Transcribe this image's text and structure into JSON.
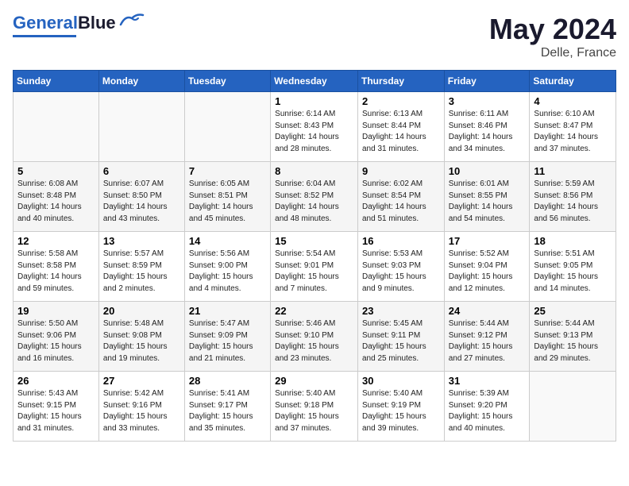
{
  "header": {
    "logo_general": "General",
    "logo_blue": "Blue",
    "month_title": "May 2024",
    "subtitle": "Delle, France"
  },
  "days_of_week": [
    "Sunday",
    "Monday",
    "Tuesday",
    "Wednesday",
    "Thursday",
    "Friday",
    "Saturday"
  ],
  "weeks": [
    [
      {
        "day": "",
        "info": ""
      },
      {
        "day": "",
        "info": ""
      },
      {
        "day": "",
        "info": ""
      },
      {
        "day": "1",
        "info": "Sunrise: 6:14 AM\nSunset: 8:43 PM\nDaylight: 14 hours\nand 28 minutes."
      },
      {
        "day": "2",
        "info": "Sunrise: 6:13 AM\nSunset: 8:44 PM\nDaylight: 14 hours\nand 31 minutes."
      },
      {
        "day": "3",
        "info": "Sunrise: 6:11 AM\nSunset: 8:46 PM\nDaylight: 14 hours\nand 34 minutes."
      },
      {
        "day": "4",
        "info": "Sunrise: 6:10 AM\nSunset: 8:47 PM\nDaylight: 14 hours\nand 37 minutes."
      }
    ],
    [
      {
        "day": "5",
        "info": "Sunrise: 6:08 AM\nSunset: 8:48 PM\nDaylight: 14 hours\nand 40 minutes."
      },
      {
        "day": "6",
        "info": "Sunrise: 6:07 AM\nSunset: 8:50 PM\nDaylight: 14 hours\nand 43 minutes."
      },
      {
        "day": "7",
        "info": "Sunrise: 6:05 AM\nSunset: 8:51 PM\nDaylight: 14 hours\nand 45 minutes."
      },
      {
        "day": "8",
        "info": "Sunrise: 6:04 AM\nSunset: 8:52 PM\nDaylight: 14 hours\nand 48 minutes."
      },
      {
        "day": "9",
        "info": "Sunrise: 6:02 AM\nSunset: 8:54 PM\nDaylight: 14 hours\nand 51 minutes."
      },
      {
        "day": "10",
        "info": "Sunrise: 6:01 AM\nSunset: 8:55 PM\nDaylight: 14 hours\nand 54 minutes."
      },
      {
        "day": "11",
        "info": "Sunrise: 5:59 AM\nSunset: 8:56 PM\nDaylight: 14 hours\nand 56 minutes."
      }
    ],
    [
      {
        "day": "12",
        "info": "Sunrise: 5:58 AM\nSunset: 8:58 PM\nDaylight: 14 hours\nand 59 minutes."
      },
      {
        "day": "13",
        "info": "Sunrise: 5:57 AM\nSunset: 8:59 PM\nDaylight: 15 hours\nand 2 minutes."
      },
      {
        "day": "14",
        "info": "Sunrise: 5:56 AM\nSunset: 9:00 PM\nDaylight: 15 hours\nand 4 minutes."
      },
      {
        "day": "15",
        "info": "Sunrise: 5:54 AM\nSunset: 9:01 PM\nDaylight: 15 hours\nand 7 minutes."
      },
      {
        "day": "16",
        "info": "Sunrise: 5:53 AM\nSunset: 9:03 PM\nDaylight: 15 hours\nand 9 minutes."
      },
      {
        "day": "17",
        "info": "Sunrise: 5:52 AM\nSunset: 9:04 PM\nDaylight: 15 hours\nand 12 minutes."
      },
      {
        "day": "18",
        "info": "Sunrise: 5:51 AM\nSunset: 9:05 PM\nDaylight: 15 hours\nand 14 minutes."
      }
    ],
    [
      {
        "day": "19",
        "info": "Sunrise: 5:50 AM\nSunset: 9:06 PM\nDaylight: 15 hours\nand 16 minutes."
      },
      {
        "day": "20",
        "info": "Sunrise: 5:48 AM\nSunset: 9:08 PM\nDaylight: 15 hours\nand 19 minutes."
      },
      {
        "day": "21",
        "info": "Sunrise: 5:47 AM\nSunset: 9:09 PM\nDaylight: 15 hours\nand 21 minutes."
      },
      {
        "day": "22",
        "info": "Sunrise: 5:46 AM\nSunset: 9:10 PM\nDaylight: 15 hours\nand 23 minutes."
      },
      {
        "day": "23",
        "info": "Sunrise: 5:45 AM\nSunset: 9:11 PM\nDaylight: 15 hours\nand 25 minutes."
      },
      {
        "day": "24",
        "info": "Sunrise: 5:44 AM\nSunset: 9:12 PM\nDaylight: 15 hours\nand 27 minutes."
      },
      {
        "day": "25",
        "info": "Sunrise: 5:44 AM\nSunset: 9:13 PM\nDaylight: 15 hours\nand 29 minutes."
      }
    ],
    [
      {
        "day": "26",
        "info": "Sunrise: 5:43 AM\nSunset: 9:15 PM\nDaylight: 15 hours\nand 31 minutes."
      },
      {
        "day": "27",
        "info": "Sunrise: 5:42 AM\nSunset: 9:16 PM\nDaylight: 15 hours\nand 33 minutes."
      },
      {
        "day": "28",
        "info": "Sunrise: 5:41 AM\nSunset: 9:17 PM\nDaylight: 15 hours\nand 35 minutes."
      },
      {
        "day": "29",
        "info": "Sunrise: 5:40 AM\nSunset: 9:18 PM\nDaylight: 15 hours\nand 37 minutes."
      },
      {
        "day": "30",
        "info": "Sunrise: 5:40 AM\nSunset: 9:19 PM\nDaylight: 15 hours\nand 39 minutes."
      },
      {
        "day": "31",
        "info": "Sunrise: 5:39 AM\nSunset: 9:20 PM\nDaylight: 15 hours\nand 40 minutes."
      },
      {
        "day": "",
        "info": ""
      }
    ]
  ]
}
